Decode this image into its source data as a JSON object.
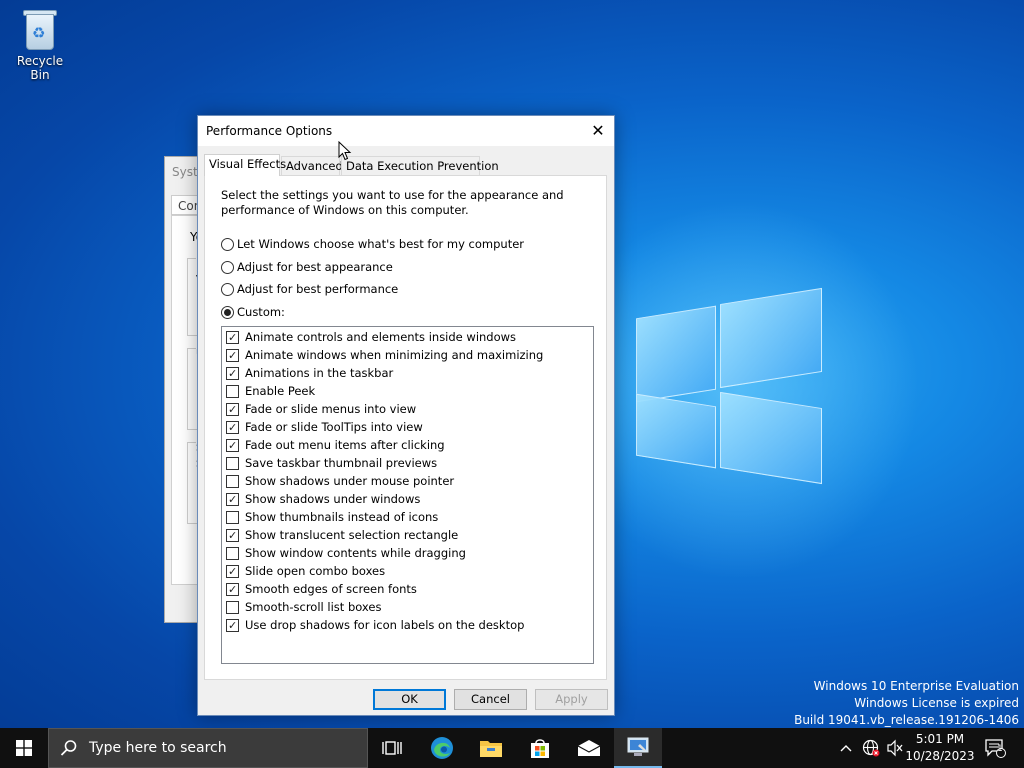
{
  "desktop": {
    "recycle_bin_label": "Recycle Bin",
    "watermark": [
      "Windows 10 Enterprise Evaluation",
      "Windows License is expired",
      "Build 19041.vb_release.191206-1406"
    ]
  },
  "background_window": {
    "title": "Syste",
    "tab": "Com",
    "partial_texts": [
      "Yo",
      "F",
      "V",
      "U",
      "D",
      "S",
      "S"
    ]
  },
  "dialog": {
    "title": "Performance Options",
    "tabs": [
      "Visual Effects",
      "Advanced",
      "Data Execution Prevention"
    ],
    "active_tab": "Visual Effects",
    "description": "Select the settings you want to use for the appearance and performance of Windows on this computer.",
    "radios": [
      {
        "label": "Let Windows choose what's best for my computer",
        "checked": false
      },
      {
        "label": "Adjust for best appearance",
        "checked": false
      },
      {
        "label": "Adjust for best performance",
        "checked": false
      },
      {
        "label": "Custom:",
        "checked": true
      }
    ],
    "options": [
      {
        "label": "Animate controls and elements inside windows",
        "checked": true
      },
      {
        "label": "Animate windows when minimizing and maximizing",
        "checked": true
      },
      {
        "label": "Animations in the taskbar",
        "checked": true
      },
      {
        "label": "Enable Peek",
        "checked": false
      },
      {
        "label": "Fade or slide menus into view",
        "checked": true
      },
      {
        "label": "Fade or slide ToolTips into view",
        "checked": true
      },
      {
        "label": "Fade out menu items after clicking",
        "checked": true
      },
      {
        "label": "Save taskbar thumbnail previews",
        "checked": false
      },
      {
        "label": "Show shadows under mouse pointer",
        "checked": false
      },
      {
        "label": "Show shadows under windows",
        "checked": true
      },
      {
        "label": "Show thumbnails instead of icons",
        "checked": false
      },
      {
        "label": "Show translucent selection rectangle",
        "checked": true
      },
      {
        "label": "Show window contents while dragging",
        "checked": false
      },
      {
        "label": "Slide open combo boxes",
        "checked": true
      },
      {
        "label": "Smooth edges of screen fonts",
        "checked": true
      },
      {
        "label": "Smooth-scroll list boxes",
        "checked": false
      },
      {
        "label": "Use drop shadows for icon labels on the desktop",
        "checked": true
      }
    ],
    "buttons": {
      "ok": "OK",
      "cancel": "Cancel",
      "apply": "Apply"
    }
  },
  "taskbar": {
    "search_placeholder": "Type here to search",
    "apps": [
      "task-view-icon",
      "edge-icon",
      "file-explorer-icon",
      "store-icon",
      "mail-icon",
      "system-properties-icon"
    ],
    "time": "5:01 PM",
    "date": "10/28/2023",
    "notification_count": "1"
  },
  "colors": {
    "accent": "#0078d7",
    "taskbar": "#101010"
  }
}
